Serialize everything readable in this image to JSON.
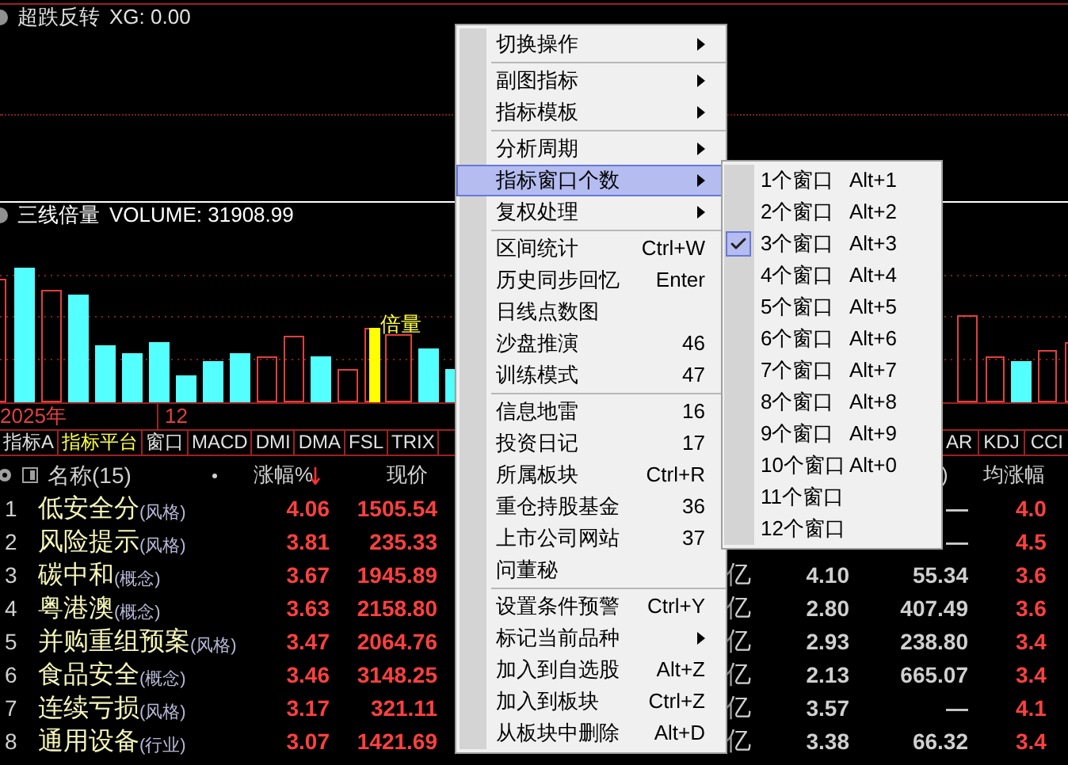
{
  "top_panel": {
    "title": "超跌反转",
    "value": "XG: 0.00"
  },
  "volume_panel": {
    "title": "三线倍量",
    "value": "VOLUME: 31908.99",
    "marker": "倍量"
  },
  "time_axis": [
    "2025年",
    "12"
  ],
  "indicator_tabs_left": [
    {
      "label": "指标A",
      "selected": false
    },
    {
      "label": "指标平台",
      "selected": true
    },
    {
      "label": "窗口",
      "selected": false
    },
    {
      "label": "MACD",
      "selected": false
    },
    {
      "label": "DMI",
      "selected": false
    },
    {
      "label": "DMA",
      "selected": false
    },
    {
      "label": "FSL",
      "selected": false
    },
    {
      "label": "TRIX",
      "selected": false
    }
  ],
  "indicator_tabs_right": [
    {
      "label": "AR",
      "selected": false
    },
    {
      "label": "KDJ",
      "selected": false
    },
    {
      "label": "CCI",
      "selected": false
    }
  ],
  "table": {
    "name_header": "名称(15)",
    "change_header": "涨幅%",
    "price_header": "现价",
    "column_7_header": ")",
    "avg_header": "均涨幅",
    "rows": [
      {
        "index": "1",
        "name": "低安全分",
        "category": "(风格)",
        "change": "4.06",
        "price": "1505.54",
        "col_b": "—",
        "avg": "4.0"
      },
      {
        "index": "2",
        "name": "风险提示",
        "category": "(风格)",
        "change": "3.81",
        "price": "235.33",
        "col_b": "—",
        "avg": "4.5"
      },
      {
        "index": "3",
        "name": "碳中和",
        "category": "(概念)",
        "change": "3.67",
        "price": "1945.89",
        "unit": "亿",
        "col_a": "4.10",
        "col_b": "55.34",
        "avg": "3.6"
      },
      {
        "index": "4",
        "name": "粤港澳",
        "category": "(概念)",
        "change": "3.63",
        "price": "2158.80",
        "unit": "亿",
        "col_a": "2.80",
        "col_b": "407.49",
        "avg": "3.6"
      },
      {
        "index": "5",
        "name": "并购重组预案",
        "category": "(风格)",
        "change": "3.47",
        "price": "2064.76",
        "unit": "亿",
        "col_a": "2.93",
        "col_b": "238.80",
        "avg": "3.4"
      },
      {
        "index": "6",
        "name": "食品安全",
        "category": "(概念)",
        "change": "3.46",
        "price": "3148.25",
        "unit": "亿",
        "col_a": "2.13",
        "col_b": "665.07",
        "avg": "3.4"
      },
      {
        "index": "7",
        "name": "连续亏损",
        "category": "(风格)",
        "change": "3.17",
        "price": "321.11",
        "unit": "亿",
        "col_a": "3.57",
        "col_b": "—",
        "avg": "4.1"
      },
      {
        "index": "8",
        "name": "通用设备",
        "category": "(行业)",
        "change": "3.07",
        "price": "1421.69",
        "unit": "亿",
        "col_a": "3.38",
        "col_b": "66.32",
        "avg": "3.4"
      }
    ]
  },
  "context_menu": {
    "groups": [
      [
        {
          "label": "切换操作",
          "has_submenu": true,
          "selected": false
        }
      ],
      [
        {
          "label": "副图指标",
          "has_submenu": true,
          "selected": false
        },
        {
          "label": "指标模板",
          "has_submenu": true,
          "selected": false
        }
      ],
      [
        {
          "label": "分析周期",
          "has_submenu": true,
          "selected": false
        },
        {
          "label": "指标窗口个数",
          "has_submenu": true,
          "selected": true
        },
        {
          "label": "复权处理",
          "has_submenu": true,
          "selected": false
        }
      ],
      [
        {
          "label": "区间统计",
          "shortcut": "Ctrl+W",
          "has_submenu": false,
          "selected": false
        },
        {
          "label": "历史同步回忆",
          "shortcut": "Enter",
          "has_submenu": false,
          "selected": false
        },
        {
          "label": "日线点数图",
          "has_submenu": false,
          "selected": false
        },
        {
          "label": "沙盘推演",
          "shortcut": "46",
          "has_submenu": false,
          "selected": false
        },
        {
          "label": "训练模式",
          "shortcut": "47",
          "has_submenu": false,
          "selected": false
        }
      ],
      [
        {
          "label": "信息地雷",
          "shortcut": "16",
          "has_submenu": false,
          "selected": false
        },
        {
          "label": "投资日记",
          "shortcut": "17",
          "has_submenu": false,
          "selected": false
        },
        {
          "label": "所属板块",
          "shortcut": "Ctrl+R",
          "has_submenu": false,
          "selected": false
        },
        {
          "label": "重仓持股基金",
          "shortcut": "36",
          "has_submenu": false,
          "selected": false
        },
        {
          "label": "上市公司网站",
          "shortcut": "37",
          "has_submenu": false,
          "selected": false
        },
        {
          "label": "问董秘",
          "has_submenu": false,
          "selected": false
        }
      ],
      [
        {
          "label": "设置条件预警",
          "shortcut": "Ctrl+Y",
          "has_submenu": false,
          "selected": false
        },
        {
          "label": "标记当前品种",
          "has_submenu": true,
          "selected": false
        },
        {
          "label": "加入到自选股",
          "shortcut": "Alt+Z",
          "has_submenu": false,
          "selected": false
        },
        {
          "label": "加入到板块",
          "shortcut": "Ctrl+Z",
          "has_submenu": false,
          "selected": false
        },
        {
          "label": "从板块中删除",
          "shortcut": "Alt+D",
          "has_submenu": false,
          "selected": false
        }
      ]
    ]
  },
  "submenu": [
    {
      "label": "1个窗口",
      "shortcut": "Alt+1",
      "checked": false
    },
    {
      "label": "2个窗口",
      "shortcut": "Alt+2",
      "checked": false
    },
    {
      "label": "3个窗口",
      "shortcut": "Alt+3",
      "checked": true
    },
    {
      "label": "4个窗口",
      "shortcut": "Alt+4",
      "checked": false
    },
    {
      "label": "5个窗口",
      "shortcut": "Alt+5",
      "checked": false
    },
    {
      "label": "6个窗口",
      "shortcut": "Alt+6",
      "checked": false
    },
    {
      "label": "7个窗口",
      "shortcut": "Alt+7",
      "checked": false
    },
    {
      "label": "8个窗口",
      "shortcut": "Alt+8",
      "checked": false
    },
    {
      "label": "9个窗口",
      "shortcut": "Alt+9",
      "checked": false
    },
    {
      "label": "10个窗口",
      "shortcut": "Alt+0",
      "checked": false
    },
    {
      "label": "11个窗口",
      "checked": false
    },
    {
      "label": "12个窗口",
      "checked": false
    }
  ]
}
